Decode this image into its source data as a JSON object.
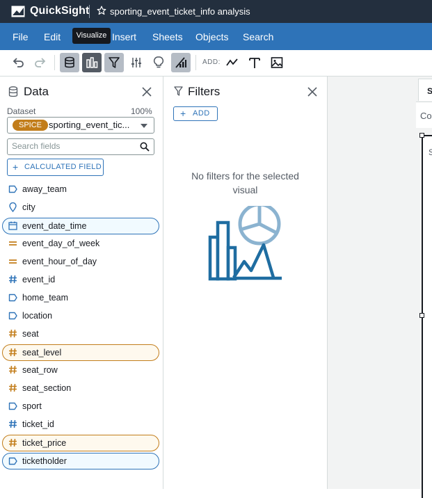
{
  "app": {
    "brand": "QuickSight",
    "analysis_title": "sporting_event_ticket_info analysis"
  },
  "menu": [
    "File",
    "Edit",
    "Insert",
    "Sheets",
    "Objects",
    "Search"
  ],
  "tooltip": "Visualize",
  "toolbar": {
    "add_label": "ADD:",
    "icons": [
      "undo-icon",
      "redo-icon",
      "data-icon",
      "visualize-icon",
      "filter-icon",
      "parameters-icon",
      "insights-icon",
      "themes-icon",
      "add-visual-icon",
      "add-text-icon",
      "add-image-icon"
    ]
  },
  "data_panel": {
    "title": "Data",
    "dataset_label": "Dataset",
    "dataset_pct": "100%",
    "spice_badge": "SPICE",
    "dataset_name": "sporting_event_tic...",
    "search_placeholder": "Search fields",
    "calc_field_label": "CALCULATED FIELD",
    "fields": [
      {
        "name": "away_team",
        "icon": "dimension-tag-icon",
        "type": "dim",
        "selected": false
      },
      {
        "name": "city",
        "icon": "location-pin-icon",
        "type": "geo",
        "selected": false
      },
      {
        "name": "event_date_time",
        "icon": "calendar-icon",
        "type": "date",
        "selected": true
      },
      {
        "name": "event_day_of_week",
        "icon": "equals-icon",
        "type": "meas",
        "selected": false
      },
      {
        "name": "event_hour_of_day",
        "icon": "equals-icon",
        "type": "meas",
        "selected": false
      },
      {
        "name": "event_id",
        "icon": "hash-icon",
        "type": "num-dim",
        "selected": false
      },
      {
        "name": "home_team",
        "icon": "dimension-tag-icon",
        "type": "dim",
        "selected": false
      },
      {
        "name": "location",
        "icon": "dimension-tag-icon",
        "type": "dim",
        "selected": false
      },
      {
        "name": "seat",
        "icon": "hash-icon",
        "type": "meas",
        "selected": false
      },
      {
        "name": "seat_level",
        "icon": "hash-icon",
        "type": "meas",
        "selected": true
      },
      {
        "name": "seat_row",
        "icon": "hash-icon",
        "type": "meas",
        "selected": false
      },
      {
        "name": "seat_section",
        "icon": "hash-icon",
        "type": "meas",
        "selected": false
      },
      {
        "name": "sport",
        "icon": "dimension-tag-icon",
        "type": "dim",
        "selected": false
      },
      {
        "name": "ticket_id",
        "icon": "hash-icon",
        "type": "num-dim",
        "selected": false
      },
      {
        "name": "ticket_price",
        "icon": "hash-icon",
        "type": "meas",
        "selected": true
      },
      {
        "name": "ticketholder",
        "icon": "dimension-tag-icon",
        "type": "dim",
        "selected": true
      }
    ]
  },
  "filters_panel": {
    "title": "Filters",
    "add_label": "ADD",
    "empty_message": "No filters for the selected visual"
  },
  "canvas": {
    "tab_label": "S",
    "top_text": "Co",
    "visual_text": "S"
  },
  "colors": {
    "titlebar": "#232f3e",
    "menubar": "#2e73b8",
    "dimension": "#2e73b8",
    "measure": "#c27d1a"
  }
}
